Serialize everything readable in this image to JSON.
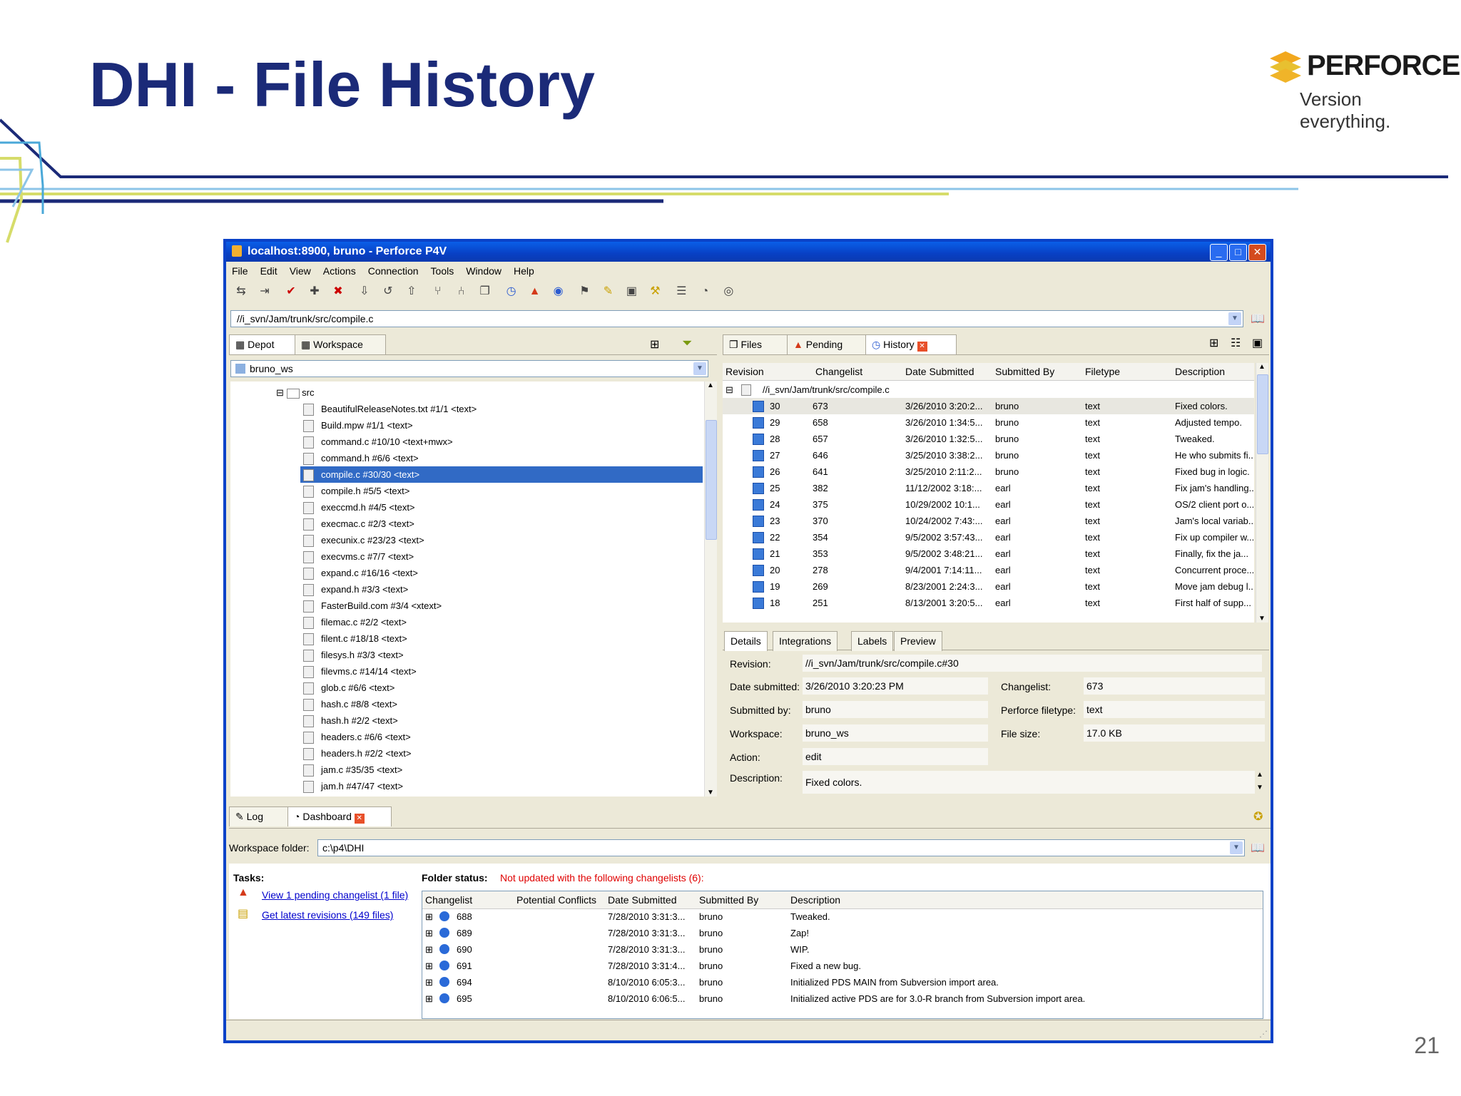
{
  "slide": {
    "title": "DHI - File History",
    "logo_name": "PERFORCE",
    "logo_tagline": "Version everything.",
    "page_number": "21"
  },
  "window": {
    "title": "localhost:8900, bruno - Perforce P4V",
    "menu": [
      "File",
      "Edit",
      "View",
      "Actions",
      "Connection",
      "Tools",
      "Window",
      "Help"
    ],
    "path": "//i_svn/Jam/trunk/src/compile.c"
  },
  "left": {
    "tabs": [
      "Depot",
      "Workspace"
    ],
    "workspace": "bruno_ws",
    "folder": "src",
    "files": [
      "BeautifulReleaseNotes.txt #1/1 <text>",
      "Build.mpw #1/1 <text>",
      "command.c #10/10 <text+mwx>",
      "command.h #6/6 <text>",
      "compile.c #30/30 <text>",
      "compile.h #5/5 <text>",
      "execcmd.h #4/5 <text>",
      "execmac.c #2/3 <text>",
      "execunix.c #23/23 <text>",
      "execvms.c #7/7 <text>",
      "expand.c #16/16 <text>",
      "expand.h #3/3 <text>",
      "FasterBuild.com #3/4 <xtext>",
      "filemac.c #2/2 <text>",
      "filent.c #18/18 <text>",
      "filesys.h #3/3 <text>",
      "filevms.c #14/14 <text>",
      "glob.c #6/6 <text>",
      "hash.c #8/8 <text>",
      "hash.h #2/2 <text>",
      "headers.c #6/6 <text>",
      "headers.h #2/2 <text>",
      "jam.c #35/35 <text>",
      "jam.h #47/47 <text>"
    ]
  },
  "right": {
    "tabs": [
      "Files",
      "Pending",
      "History"
    ],
    "columns": [
      "Revision",
      "Changelist",
      "Date Submitted",
      "Submitted By",
      "Filetype",
      "Description"
    ],
    "root": "//i_svn/Jam/trunk/src/compile.c",
    "rows": [
      {
        "rev": "30",
        "cl": "673",
        "date": "3/26/2010 3:20:2...",
        "by": "bruno",
        "type": "text",
        "desc": "Fixed colors."
      },
      {
        "rev": "29",
        "cl": "658",
        "date": "3/26/2010 1:34:5...",
        "by": "bruno",
        "type": "text",
        "desc": "Adjusted tempo."
      },
      {
        "rev": "28",
        "cl": "657",
        "date": "3/26/2010 1:32:5...",
        "by": "bruno",
        "type": "text",
        "desc": "Tweaked."
      },
      {
        "rev": "27",
        "cl": "646",
        "date": "3/25/2010 3:38:2...",
        "by": "bruno",
        "type": "text",
        "desc": "He who submits fi..."
      },
      {
        "rev": "26",
        "cl": "641",
        "date": "3/25/2010 2:11:2...",
        "by": "bruno",
        "type": "text",
        "desc": "Fixed bug in logic."
      },
      {
        "rev": "25",
        "cl": "382",
        "date": "11/12/2002 3:18:...",
        "by": "earl",
        "type": "text",
        "desc": "Fix jam's handling..."
      },
      {
        "rev": "24",
        "cl": "375",
        "date": "10/29/2002 10:1...",
        "by": "earl",
        "type": "text",
        "desc": "OS/2 client port o..."
      },
      {
        "rev": "23",
        "cl": "370",
        "date": "10/24/2002 7:43:...",
        "by": "earl",
        "type": "text",
        "desc": "Jam's local variab..."
      },
      {
        "rev": "22",
        "cl": "354",
        "date": "9/5/2002 3:57:43...",
        "by": "earl",
        "type": "text",
        "desc": "Fix up compiler w..."
      },
      {
        "rev": "21",
        "cl": "353",
        "date": "9/5/2002 3:48:21...",
        "by": "earl",
        "type": "text",
        "desc": "Finally, fix the ja..."
      },
      {
        "rev": "20",
        "cl": "278",
        "date": "9/4/2001 7:14:11...",
        "by": "earl",
        "type": "text",
        "desc": "Concurrent proce..."
      },
      {
        "rev": "19",
        "cl": "269",
        "date": "8/23/2001 2:24:3...",
        "by": "earl",
        "type": "text",
        "desc": "Move jam debug l..."
      },
      {
        "rev": "18",
        "cl": "251",
        "date": "8/13/2001 3:20:5...",
        "by": "earl",
        "type": "text",
        "desc": "First half of supp..."
      }
    ],
    "detail_tabs": [
      "Details",
      "Integrations",
      "Labels",
      "Preview"
    ],
    "details": {
      "revision_label": "Revision:",
      "revision": "//i_svn/Jam/trunk/src/compile.c#30",
      "date_label": "Date submitted:",
      "date": "3/26/2010 3:20:23 PM",
      "changelist_label": "Changelist:",
      "changelist": "673",
      "by_label": "Submitted by:",
      "by": "bruno",
      "filetype_label": "Perforce filetype:",
      "filetype": "text",
      "workspace_label": "Workspace:",
      "workspace": "bruno_ws",
      "size_label": "File size:",
      "size": "17.0 KB",
      "action_label": "Action:",
      "action": "edit",
      "desc_label": "Description:",
      "desc": "Fixed colors."
    }
  },
  "bottom": {
    "tabs": [
      "Log",
      "Dashboard"
    ],
    "workspace_folder_label": "Workspace folder:",
    "workspace_folder": "c:\\p4\\DHI",
    "tasks_label": "Tasks:",
    "task1": "View 1 pending changelist (1 file)",
    "task2": "Get latest revisions (149 files)",
    "folder_status_label": "Folder status:",
    "folder_status": "Not updated with the following changelists (6):",
    "columns": [
      "Changelist",
      "Potential Conflicts",
      "Date Submitted",
      "Submitted By",
      "Description"
    ],
    "rows": [
      {
        "cl": "688",
        "date": "7/28/2010 3:31:3...",
        "by": "bruno",
        "desc": "Tweaked."
      },
      {
        "cl": "689",
        "date": "7/28/2010 3:31:3...",
        "by": "bruno",
        "desc": "Zap!"
      },
      {
        "cl": "690",
        "date": "7/28/2010 3:31:3...",
        "by": "bruno",
        "desc": "WIP."
      },
      {
        "cl": "691",
        "date": "7/28/2010 3:31:4...",
        "by": "bruno",
        "desc": "Fixed a new bug."
      },
      {
        "cl": "694",
        "date": "8/10/2010 6:05:3...",
        "by": "bruno",
        "desc": "Initialized PDS MAIN from Subversion import area."
      },
      {
        "cl": "695",
        "date": "8/10/2010 6:06:5...",
        "by": "bruno",
        "desc": "Initialized active PDS are for 3.0-R branch from Subversion import area."
      }
    ]
  },
  "colors": {
    "title": "#1b2a78",
    "selection": "#316ac5",
    "window_frame": "#0a42c8",
    "status_red": "#e00000"
  }
}
